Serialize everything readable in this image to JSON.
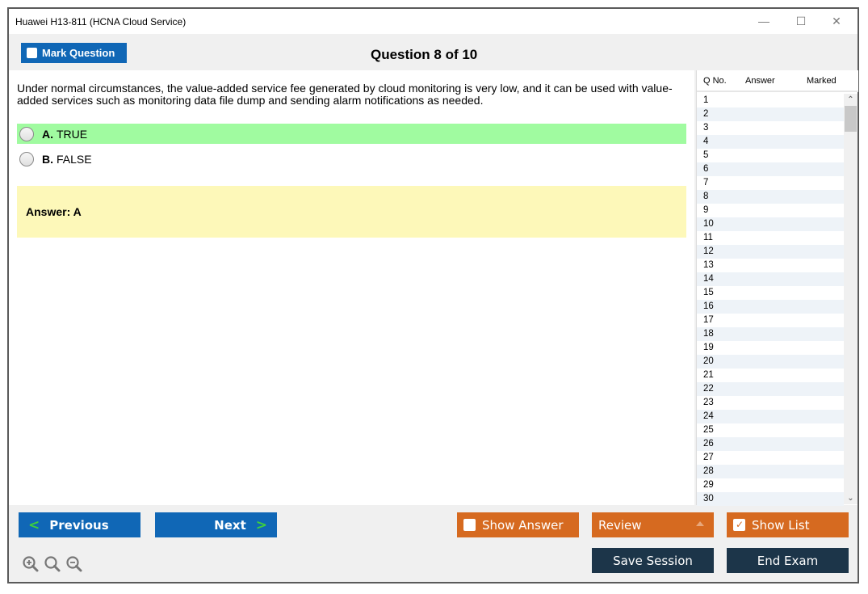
{
  "window": {
    "title": "Huawei H13-811 (HCNA Cloud Service)",
    "controls": {
      "minimize": "—",
      "maximize": "☐",
      "close": "✕"
    }
  },
  "toolbar": {
    "mark_question_label": "Mark Question",
    "mark_question_checked": false,
    "question_title": "Question 8 of 10"
  },
  "question": {
    "text": "Under normal circumstances, the value-added service fee generated by cloud monitoring is very low, and it can be used with value-added services such as monitoring data file dump and sending alarm notifications as needed.",
    "options": [
      {
        "letter": "A.",
        "text": "TRUE",
        "highlighted": true,
        "highlight_color": "#a0fba0"
      },
      {
        "letter": "B.",
        "text": "FALSE",
        "highlighted": false
      }
    ],
    "answer_text": "Answer: A",
    "answer_bg": "#fdf8b9"
  },
  "question_list": {
    "headers": {
      "qno": "Q No.",
      "answer": "Answer",
      "marked": "Marked"
    },
    "rows": [
      "1",
      "2",
      "3",
      "4",
      "5",
      "6",
      "7",
      "8",
      "9",
      "10",
      "11",
      "12",
      "13",
      "14",
      "15",
      "16",
      "17",
      "18",
      "19",
      "20",
      "21",
      "22",
      "23",
      "24",
      "25",
      "26",
      "27",
      "28",
      "29",
      "30"
    ]
  },
  "footer": {
    "previous_label": "Previous",
    "next_label": "Next",
    "show_answer_label": "Show Answer",
    "show_answer_checked": false,
    "review_label": "Review",
    "show_list_label": "Show List",
    "show_list_checked": true,
    "save_session_label": "Save Session",
    "end_exam_label": "End Exam"
  },
  "colors": {
    "primary_blue": "#1067b6",
    "orange": "#d66a20",
    "navy": "#1c3549",
    "chevron_green": "#3ecf3e"
  }
}
